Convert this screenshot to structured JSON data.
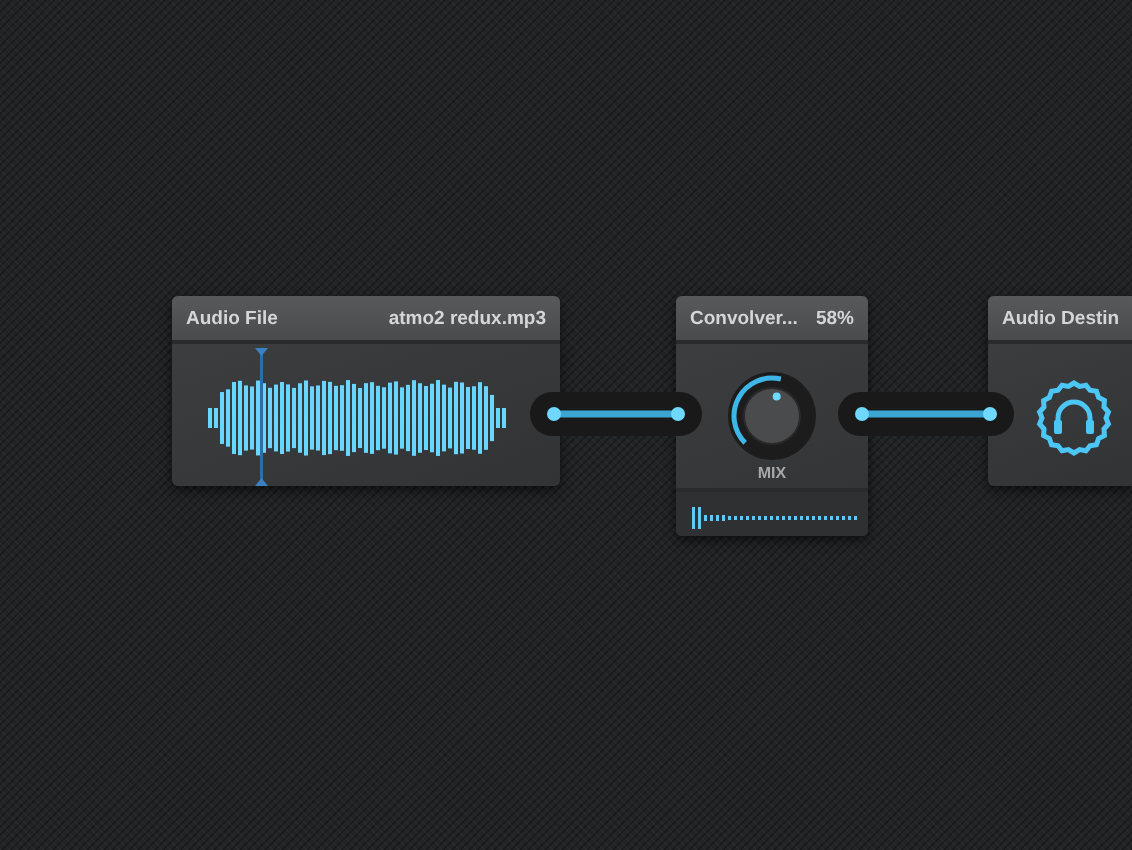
{
  "nodes": [
    {
      "kind": "file",
      "title": "Audio File",
      "value": "atmo2 redux.mp3"
    },
    {
      "kind": "effect",
      "title": "Convolver...",
      "value": "58%",
      "knob": {
        "label": "MIX"
      }
    },
    {
      "kind": "destination",
      "title": "Audio Destin"
    }
  ]
}
